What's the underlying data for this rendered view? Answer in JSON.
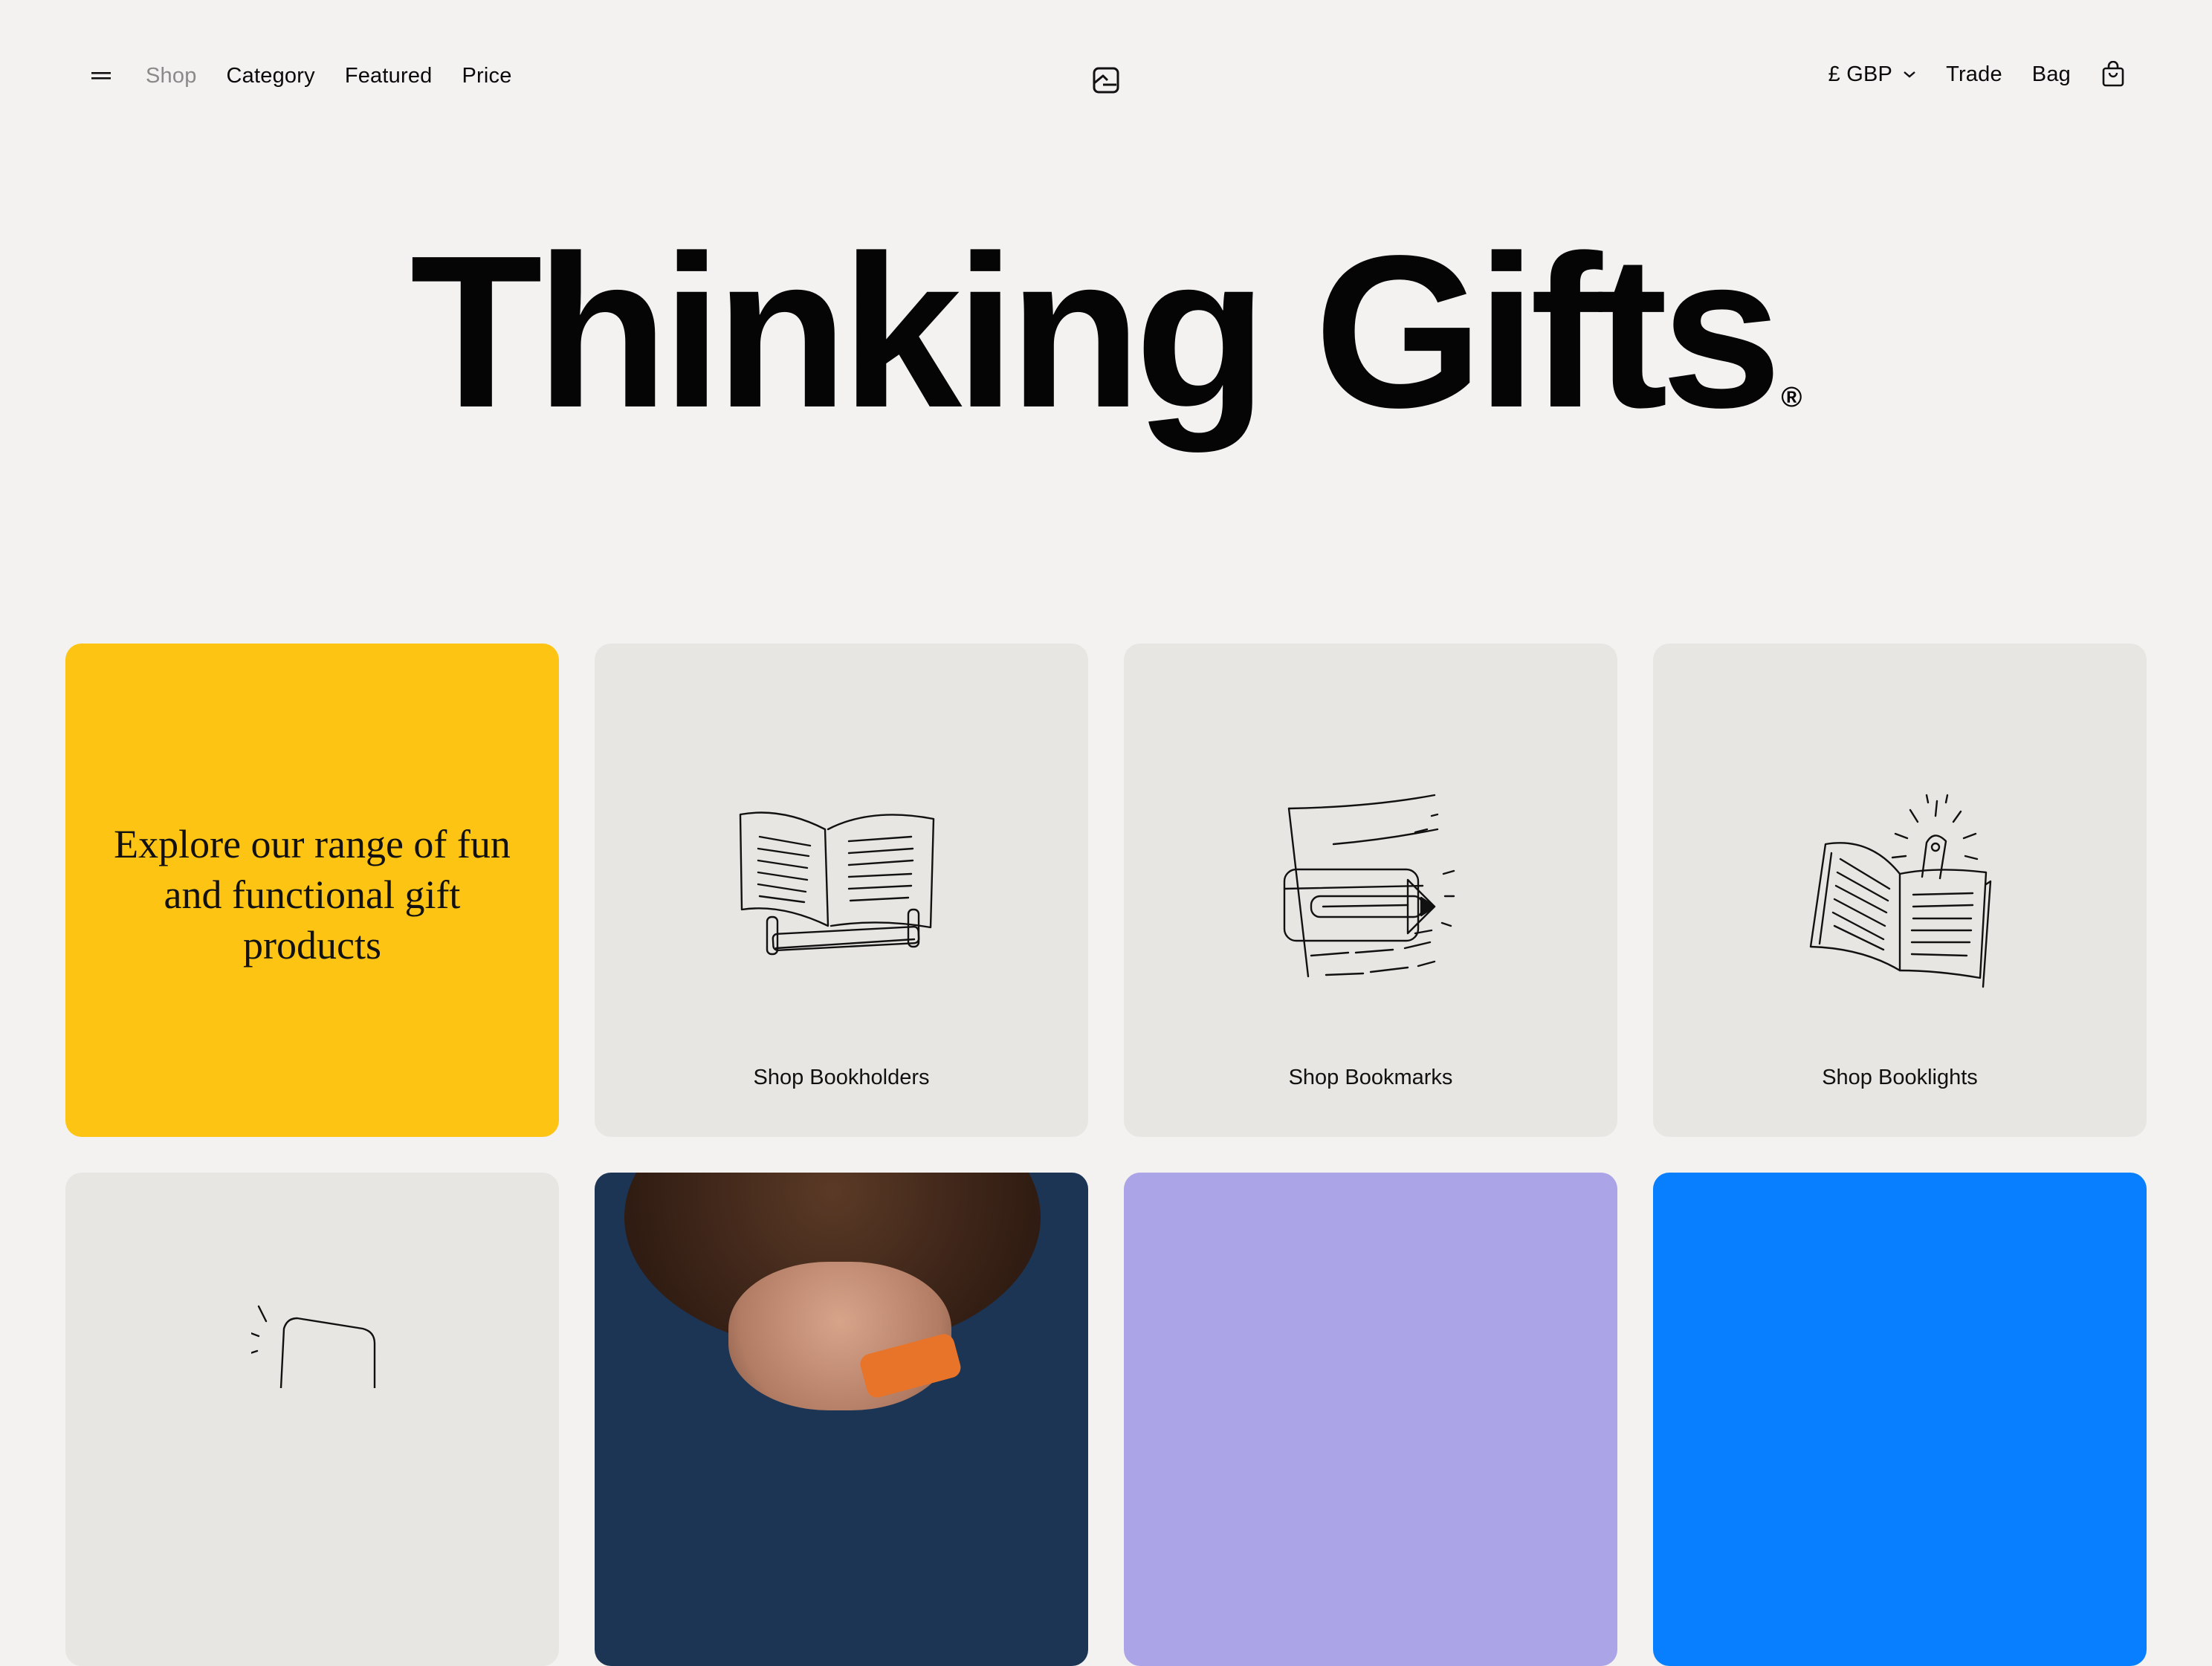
{
  "header": {
    "nav_left": [
      "Shop",
      "Category",
      "Featured",
      "Price"
    ],
    "currency": "£ GBP",
    "trade": "Trade",
    "bag": "Bag"
  },
  "hero": {
    "title": "Thinking Gifts",
    "mark": "®"
  },
  "promo": {
    "text": "Explore our range of fun and functional gift products",
    "color": "#fdc414"
  },
  "cards": [
    {
      "label": "Shop Bookholders",
      "icon": "bookholder-icon"
    },
    {
      "label": "Shop Bookmarks",
      "icon": "bookmark-icon"
    },
    {
      "label": "Shop Booklights",
      "icon": "booklight-icon"
    }
  ],
  "colors": {
    "background": "#f3f2f1",
    "card": "#e7e6e3",
    "purple": "#aba4e6",
    "blue": "#077ffe"
  }
}
